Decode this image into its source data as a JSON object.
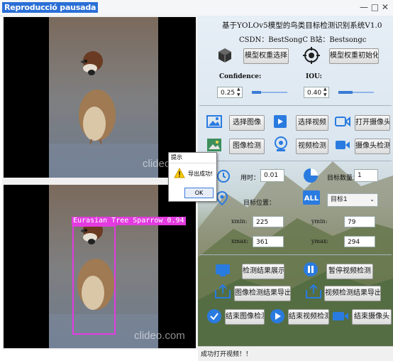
{
  "overlay": {
    "label": "Reproducció pausada"
  },
  "window": {
    "controls": "—  □  ✕"
  },
  "video": {
    "watermark": "clideo.com",
    "detection_label": "Eurasian Tree Sparrow 0.94"
  },
  "header": {
    "title": "基于YOLOv5模型的鸟类目标检测识别系统V1.0",
    "csdn": "CSDN：BestSongC",
    "bilibili": "B站：Bestsongc"
  },
  "model": {
    "select_weights": "模型权重选择",
    "init_weights": "模型权重初始化"
  },
  "params": {
    "confidence_label": "Confidence:",
    "confidence_value": "0.25",
    "iou_label": "IOU:",
    "iou_value": "0.40",
    "confidence_level": 0.25,
    "iou_level": 0.4
  },
  "actions": {
    "select_image": "选择图像",
    "select_video": "选择视频",
    "open_camera": "打开摄像头",
    "image_detect": "图像检测",
    "video_detect": "视频检测",
    "camera_detect": "摄像头检测"
  },
  "stats": {
    "time_label": "用时：",
    "time_value": "0.01",
    "count_label": "目标数量：",
    "count_value": "1",
    "position_label": "目标位置：",
    "target_select": "目标1",
    "xmin_label": "xmin:",
    "xmin_value": "225",
    "ymin_label": "ymin:",
    "ymin_value": "79",
    "xmax_label": "xmax:",
    "xmax_value": "361",
    "ymax_label": "ymax:",
    "ymax_value": "294"
  },
  "results": {
    "show_results": "检测结果展示",
    "pause_video": "暂停视频检测",
    "export_image": "图像检测结果导出",
    "export_video": "视频检测结果导出",
    "end_image": "结束图像检测",
    "end_video": "结束视频检测",
    "end_camera": "结束摄像头"
  },
  "dialog": {
    "title": "提示",
    "message": "导出成功!",
    "ok": "OK"
  },
  "status": {
    "text": "成功打开视频！！"
  }
}
